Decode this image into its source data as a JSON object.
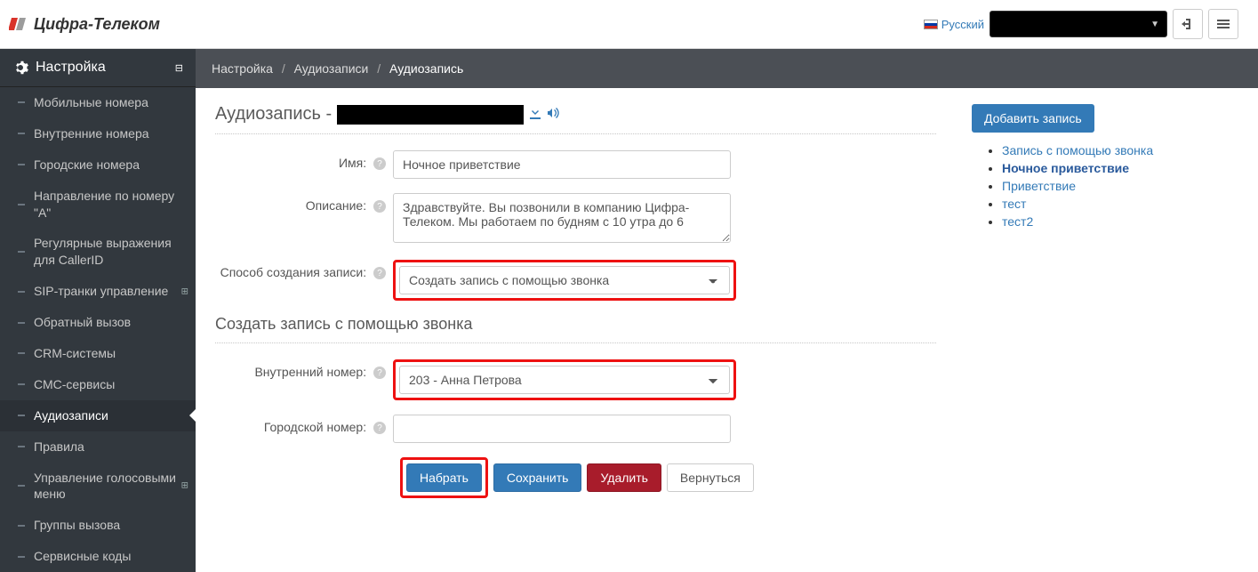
{
  "brand": "Цифра-Телеком",
  "header": {
    "language": "Русский",
    "account_redacted": true
  },
  "sidebar": {
    "title": "Настройка",
    "items": [
      {
        "label": "Мобильные номера",
        "ext": false
      },
      {
        "label": "Внутренние номера",
        "ext": false
      },
      {
        "label": "Городские номера",
        "ext": false
      },
      {
        "label": "Направление по номеру \"A\"",
        "ext": false
      },
      {
        "label": "Регулярные выражения для CallerID",
        "ext": false
      },
      {
        "label": "SIP-транки управление",
        "ext": true
      },
      {
        "label": "Обратный вызов",
        "ext": false
      },
      {
        "label": "CRM-системы",
        "ext": false
      },
      {
        "label": "СМС-сервисы",
        "ext": false
      },
      {
        "label": "Аудиозаписи",
        "ext": false,
        "active": true
      },
      {
        "label": "Правила",
        "ext": false
      },
      {
        "label": "Управление голосовыми меню",
        "ext": true
      },
      {
        "label": "Группы вызова",
        "ext": false
      },
      {
        "label": "Сервисные коды",
        "ext": false
      }
    ]
  },
  "breadcrumbs": {
    "a": "Настройка",
    "b": "Аудиозаписи",
    "c": "Аудиозапись"
  },
  "page": {
    "heading_prefix": "Аудиозапись -",
    "labels": {
      "name": "Имя:",
      "description": "Описание:",
      "method": "Способ создания записи:",
      "section2": "Создать запись с помощью звонка",
      "internal_number": "Внутренний номер:",
      "city_number": "Городской номер:"
    },
    "values": {
      "name": "Ночное приветствие",
      "description": "Здравствуйте. Вы позвонили в компанию Цифра-Телеком. Мы работаем по будням с 10 утра до 6",
      "method_selected": "Создать запись с помощью звонка",
      "internal_selected": "203 - Анна Петрова",
      "city_number": ""
    },
    "buttons": {
      "dial": "Набрать",
      "save": "Сохранить",
      "delete": "Удалить",
      "back": "Вернуться"
    }
  },
  "right": {
    "add_button": "Добавить запись",
    "records": [
      {
        "label": "Запись с помощью звонка"
      },
      {
        "label": "Ночное приветствие",
        "active": true
      },
      {
        "label": "Приветствие"
      },
      {
        "label": "тест"
      },
      {
        "label": "тест2"
      }
    ]
  }
}
